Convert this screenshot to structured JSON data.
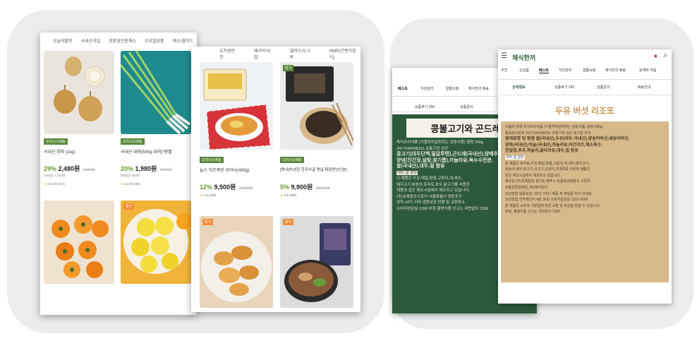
{
  "left_shop": {
    "back_nav": [
      "오늘의할인",
      "국내산과일",
      "친환경인증채소",
      "우리쌀상품",
      "채소/샐러드"
    ],
    "front_nav": [
      "유치원반찬",
      "베이비식/밀",
      "샐러드/도시락",
      "HMR(간편가정식)"
    ],
    "products": [
      {
        "tag": "오리시스배송",
        "name": "국내산 양파 (1kg)",
        "discount": "29%",
        "price": "2,480원",
        "original": "3,500원",
        "unit": "100g당 1,000원",
        "rating": "4.8 (20,447)"
      },
      {
        "tag": "오리시스배송",
        "name": "국내산 대파(500g 내외)*봉별",
        "discount": "20%",
        "price": "1,980원",
        "original": "2,500원",
        "unit": "500g당 990원",
        "rating": "4.9 (9,349)"
      },
      {
        "tag": "오리시스배송",
        "name": "늘스 치즈폭탄 라자냐(400g)",
        "discount": "12%",
        "price": "9,500원",
        "original": "10,900원",
        "unit": "",
        "rating": "4.9 (105)"
      },
      {
        "tag": "오리시스배송",
        "name": "[명사]숙성한 한우사골 옛날 짜장면(2인분)",
        "discount": "5%",
        "price": "9,900원",
        "original": "10,500원",
        "unit": "",
        "rating": "4.8 (360)"
      }
    ],
    "badges": {
      "b1": "특가",
      "b2": "특가",
      "b3": "특가",
      "b4": "특가"
    }
  },
  "right_app": {
    "header_title": "채식한끼",
    "menu": [
      "추천",
      "신상품",
      "베스트",
      "식단관리",
      "알뜰쇼핑",
      "채식전국 배송",
      "원재마 자음"
    ],
    "active_menu": "베스트",
    "back_tabs": [
      "베스트",
      "식단관리",
      "알뜰쇼핑",
      "채식전국 배송"
    ],
    "back_sub": [
      "상품후기 250",
      "상품문의"
    ],
    "front_sub": [
      "상세정보",
      "상품후기 250",
      "상품문의",
      "배송안내"
    ],
    "back_detail": {
      "title": "콩불고기와 곤드레밥",
      "lines": [
        "즉석조리식품 (가열하여섭취하는 냉동식품)   중량  240g",
        "2017044338241        유통기한  상단",
        "콩고기(대두단백,밀글루텐),곤드레(국내산),양배추,",
        "양념(진간장,설탕,참기름),카놀라유,옥수수전분,",
        "쌀(국내산),대두,밀 함유",
        "이 제품은 우유,메밀,땅콩,고등어,게,새우,",
        "돼지고기,복숭아,토마토,호두,닭고기를 사용한",
        "제품과 같은 제조시설에서 제조하고 있습니다.",
        "(주)초록밥상스토어 서울특별시 영등포구",
        "영하-18℃ 이하 냉동보관     반품 및 교환장소",
        "소비자상담실 1399  부정·불량식품 신고는 국번없이 1399"
      ],
      "highlight": "대두,밀 함유"
    },
    "front_detail": {
      "title": "두유 버섯 리조또",
      "lines": [
        "식품의 유형  즉석조리식품 (가열하여섭취하는 냉동식품)   중량  240g",
        "품목보고번호  2017044338241          유통기한  상단 표기일 까지",
        "원재료명 및 함량  쌀(국내산),두유(대두:국내산),양송이버섯,새송이버섯,",
        "양파(국내산),마늘(국내산),카놀라유,비건치즈,채소육수,",
        "천일염,후추,파슬리,올리브유,대두,밀 함유",
        "본 제품은 토마토,우유,메밀,땅콩,고등어,게,새우,돼지고기,",
        "복숭아,호두,닭고기,쇠고기,오징어,조개류를 사용한 제품과",
        "같은 제조시설에서 제조하고 있습니다.",
        "제조원  (주)초록밥상 경기도 파주시        반품및교환장소  구입처",
        "유통전문판매원  (주)채식한끼",
        "보관방법  냉동보관 -18℃ 이하 / 해동 후 재냉동 하지 마세요",
        "조리방법  전자레인지 4분 30초       소비자상담실  1522-2090",
        "본 제품은 소비자 기본법에 따른 교환 및 보상을 받을 수 있습니다.",
        "부정, 불량식품 신고는 국번없이 1399"
      ],
      "highlight": "대두,밀 함유"
    }
  },
  "colors": {
    "accent_green": "#2d5a3a",
    "beige": "#d7b98a",
    "discount_green": "#6a9a2e",
    "badge_orange": "#f08c3a"
  }
}
